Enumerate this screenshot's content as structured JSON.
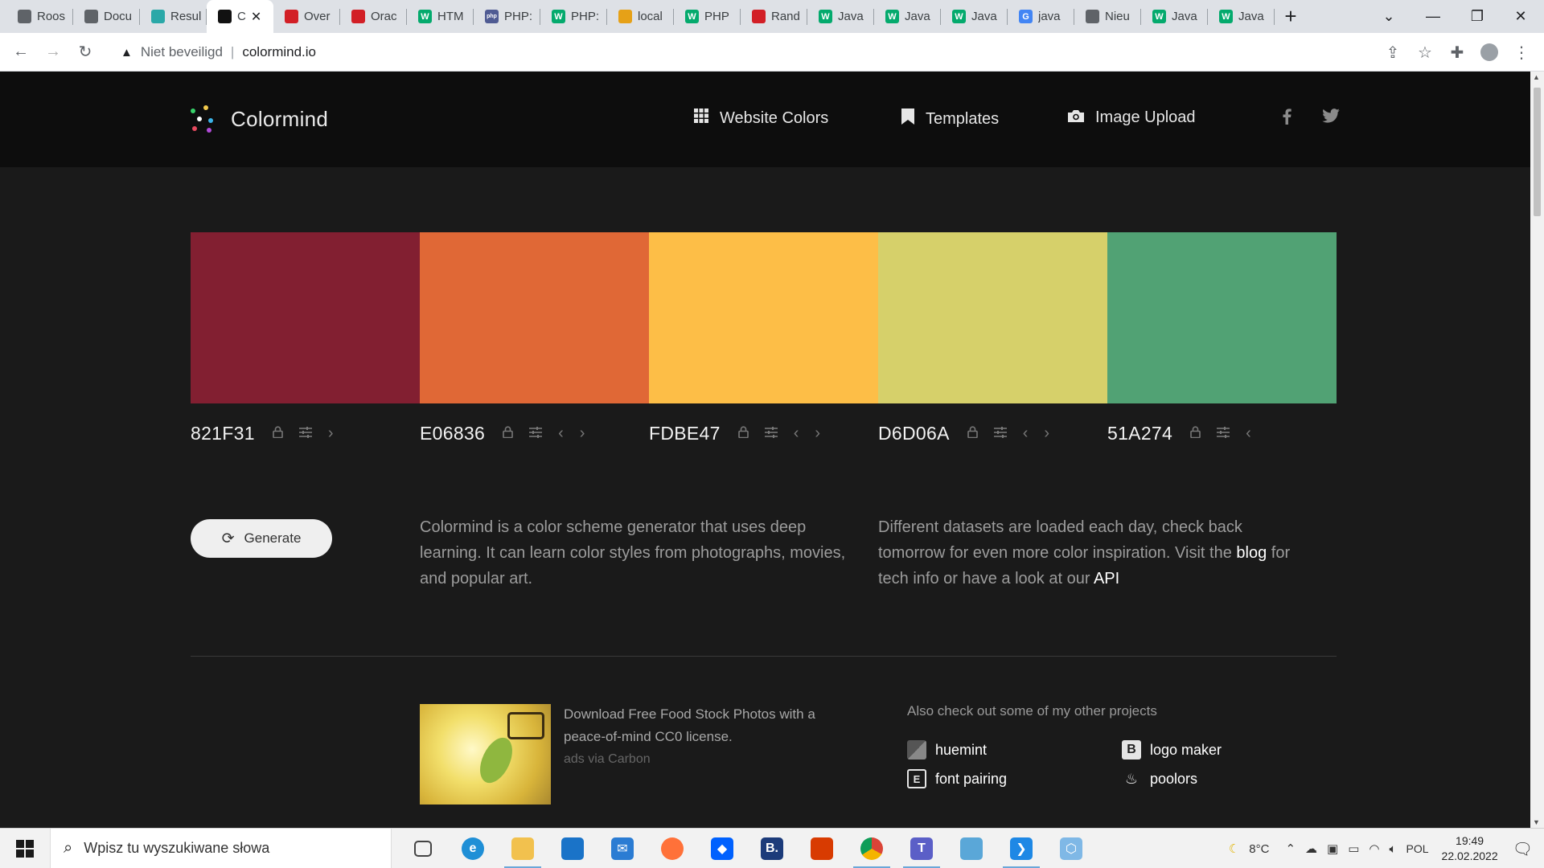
{
  "browser": {
    "tabs": [
      {
        "title": "Roos",
        "favicon_color": "#5f6368",
        "favicon_glyph": ""
      },
      {
        "title": "Docu",
        "favicon_color": "#5f6368",
        "favicon_glyph": ""
      },
      {
        "title": "Resul",
        "favicon_color": "#2aa8a8",
        "favicon_glyph": ""
      },
      {
        "title": "C",
        "favicon_color": "#111111",
        "favicon_glyph": "",
        "active": true
      },
      {
        "title": "Over",
        "favicon_color": "#d21f26",
        "favicon_glyph": ""
      },
      {
        "title": "Orac",
        "favicon_color": "#d21f26",
        "favicon_glyph": ""
      },
      {
        "title": "HTM",
        "favicon_color": "#04aa6d",
        "favicon_glyph": "W"
      },
      {
        "title": "PHP:",
        "favicon_color": "#4f5b93",
        "favicon_glyph": "php"
      },
      {
        "title": "PHP:",
        "favicon_color": "#04aa6d",
        "favicon_glyph": "W"
      },
      {
        "title": "local",
        "favicon_color": "#e6a117",
        "favicon_glyph": ""
      },
      {
        "title": "PHP",
        "favicon_color": "#04aa6d",
        "favicon_glyph": "W"
      },
      {
        "title": "Rand",
        "favicon_color": "#d21f26",
        "favicon_glyph": ""
      },
      {
        "title": "Java",
        "favicon_color": "#04aa6d",
        "favicon_glyph": "W"
      },
      {
        "title": "Java",
        "favicon_color": "#04aa6d",
        "favicon_glyph": "W"
      },
      {
        "title": "Java",
        "favicon_color": "#04aa6d",
        "favicon_glyph": "W"
      },
      {
        "title": "java",
        "favicon_color": "#4285f4",
        "favicon_glyph": "G"
      },
      {
        "title": "Nieu",
        "favicon_color": "#5f6368",
        "favicon_glyph": ""
      },
      {
        "title": "Java",
        "favicon_color": "#04aa6d",
        "favicon_glyph": "W"
      },
      {
        "title": "Java",
        "favicon_color": "#04aa6d",
        "favicon_glyph": "W"
      }
    ],
    "new_tab": "+",
    "security_label": "Niet beveiligd",
    "url": "colormind.io"
  },
  "site": {
    "brand": "Colormind",
    "nav": [
      {
        "label": "Website Colors",
        "icon": "grid-icon"
      },
      {
        "label": "Templates",
        "icon": "bookmark-icon"
      },
      {
        "label": "Image Upload",
        "icon": "camera-icon"
      }
    ],
    "social": [
      {
        "icon": "facebook-icon",
        "glyph": "f"
      },
      {
        "icon": "twitter-icon",
        "glyph": "t"
      }
    ]
  },
  "palette": [
    {
      "hex": "821F31",
      "color": "#821F31",
      "locked": false,
      "has_prev": false,
      "has_next": true
    },
    {
      "hex": "E06836",
      "color": "#E06836",
      "locked": false,
      "has_prev": true,
      "has_next": true
    },
    {
      "hex": "FDBE47",
      "color": "#FDBE47",
      "locked": false,
      "has_prev": true,
      "has_next": true
    },
    {
      "hex": "D6D06A",
      "color": "#D6D06A",
      "locked": false,
      "has_prev": true,
      "has_next": true
    },
    {
      "hex": "51A274",
      "color": "#51A274",
      "locked": false,
      "has_prev": true,
      "has_next": false
    }
  ],
  "generate": {
    "label": "Generate"
  },
  "description": {
    "left": "Colormind is a color scheme generator that uses deep learning. It can learn color styles from photographs, movies, and popular art.",
    "right_prefix": "Different datasets are loaded each day, check back tomorrow for even more color inspiration. Visit the",
    "blog_link": "blog",
    "right_middle": "for tech info or have a look at our",
    "api_link": "API"
  },
  "ad": {
    "text": "Download Free Food Stock Photos with a peace-of-mind CC0 license.",
    "via": "ads via Carbon"
  },
  "projects": {
    "heading": "Also check out some of my other projects",
    "items": [
      {
        "label": "huemint",
        "icon": "huemint-icon"
      },
      {
        "label": "logo maker",
        "icon": "logo-maker-icon"
      },
      {
        "label": "font pairing",
        "icon": "font-pairing-icon"
      },
      {
        "label": "poolors",
        "icon": "poolors-icon"
      }
    ]
  },
  "taskbar": {
    "search_placeholder": "Wpisz tu wyszukiwane słowa",
    "weather": "8°C",
    "language": "POL",
    "time": "19:49",
    "date": "22.02.2022",
    "apps": [
      {
        "name": "task-view",
        "color": "#444444",
        "glyph": ""
      },
      {
        "name": "edge",
        "color": "#1f8fd6",
        "glyph": "e"
      },
      {
        "name": "file-explorer",
        "color": "#f2c14e",
        "glyph": ""
      },
      {
        "name": "microsoft-store",
        "color": "#1a73c8",
        "glyph": ""
      },
      {
        "name": "mail",
        "color": "#2b7cd3",
        "glyph": "✉"
      },
      {
        "name": "firefox",
        "color": "#ff7139",
        "glyph": ""
      },
      {
        "name": "dropbox",
        "color": "#0061fe",
        "glyph": "◆"
      },
      {
        "name": "booking",
        "color": "#1c3b7a",
        "glyph": "B."
      },
      {
        "name": "office",
        "color": "#d83b01",
        "glyph": ""
      },
      {
        "name": "chrome",
        "color": "#db4437",
        "glyph": ""
      },
      {
        "name": "teams",
        "color": "#5b5fc7",
        "glyph": "T"
      },
      {
        "name": "notepad",
        "color": "#5aa7d8",
        "glyph": ""
      },
      {
        "name": "vscode",
        "color": "#1e88e5",
        "glyph": "❯"
      },
      {
        "name": "app-hex",
        "color": "#7fb8e6",
        "glyph": "⬡"
      }
    ]
  }
}
